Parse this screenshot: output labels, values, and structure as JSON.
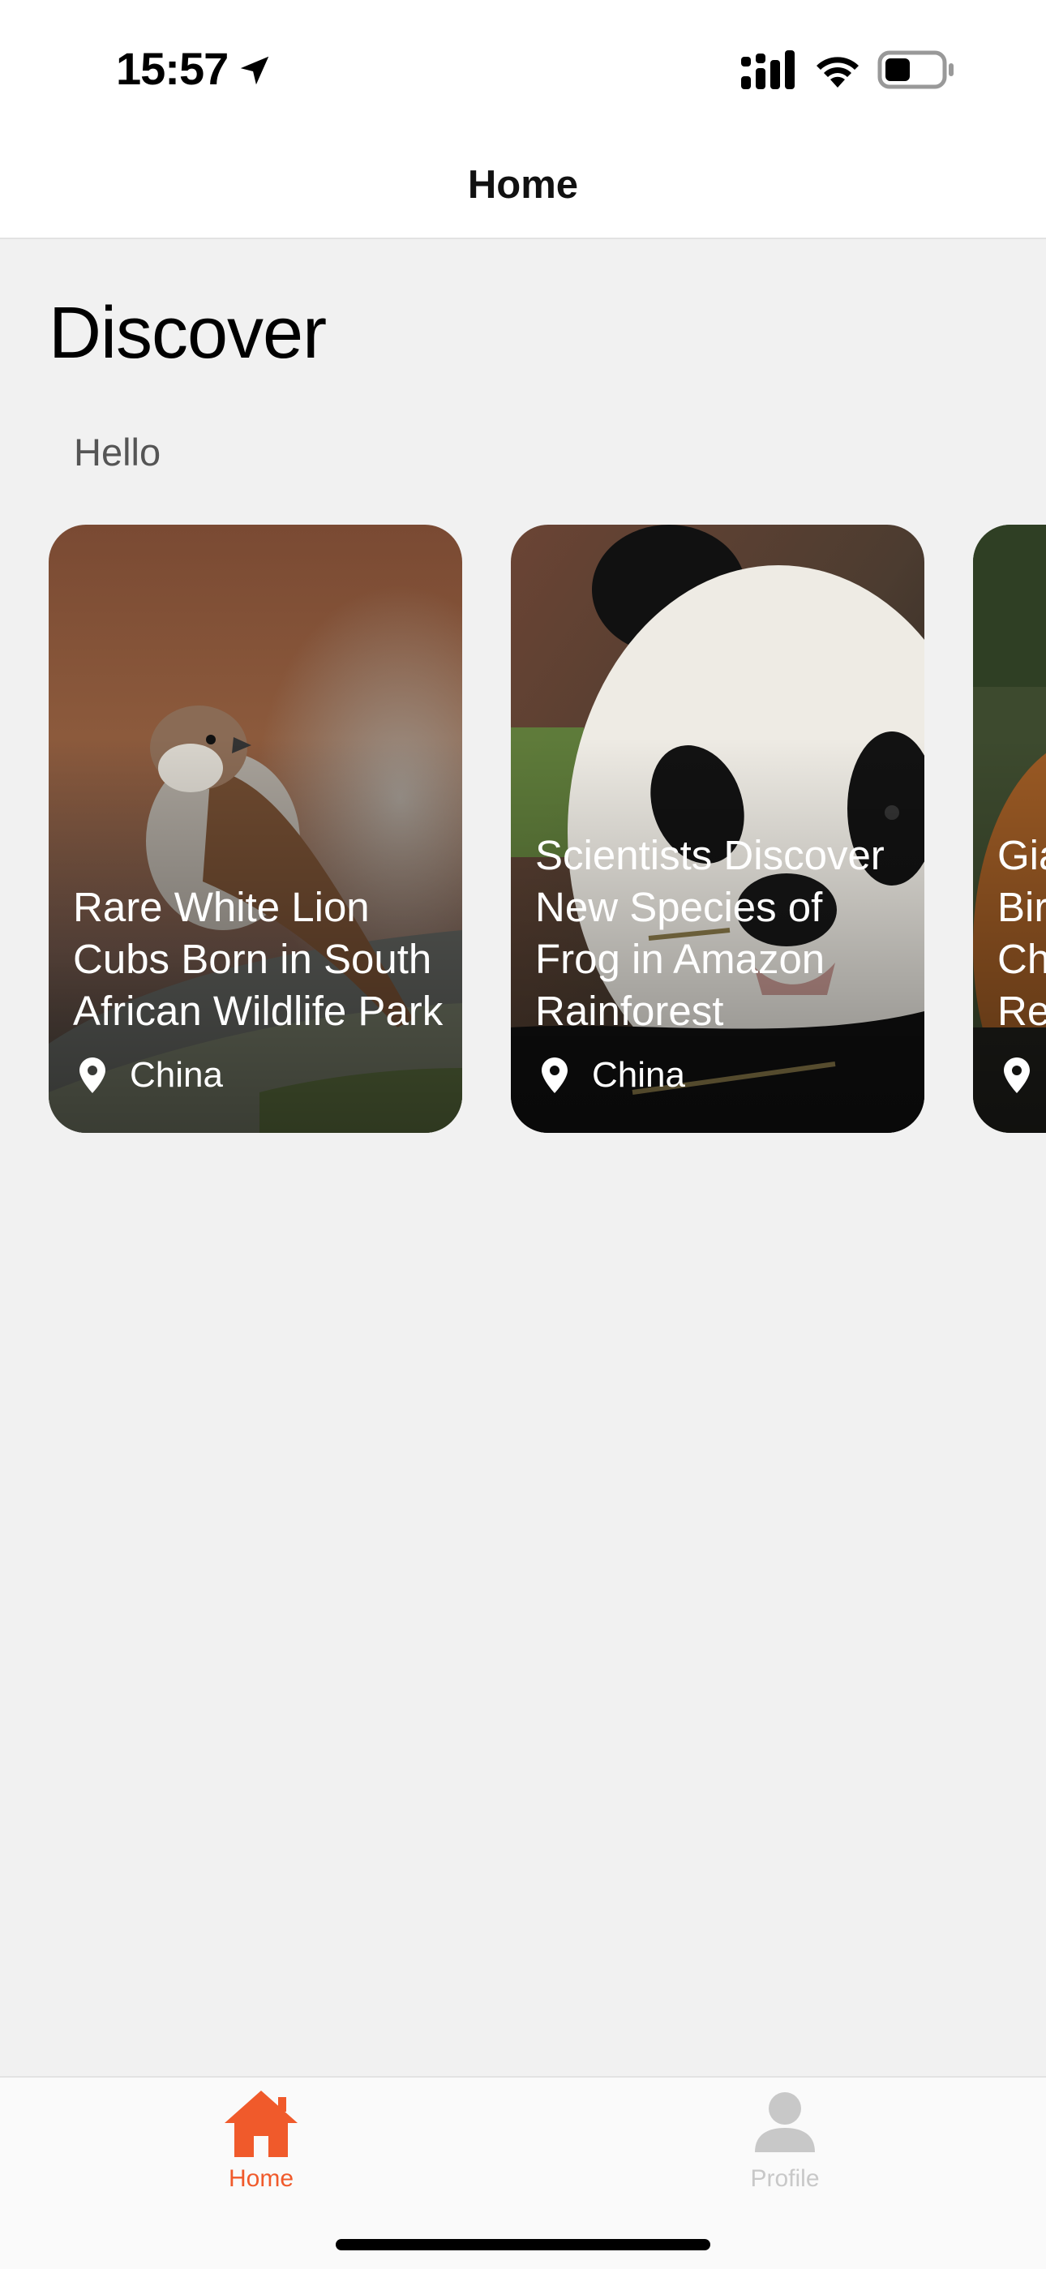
{
  "status_bar": {
    "time": "15:57",
    "icons": [
      "location-arrow-icon",
      "signal-icon",
      "wifi-icon",
      "battery-icon"
    ]
  },
  "nav": {
    "title": "Home"
  },
  "page": {
    "heading": "Discover",
    "greeting": "Hello"
  },
  "cards": [
    {
      "title": "Rare White Lion Cubs Born in South African Wildlife Park",
      "location": "China",
      "image": "sparrow on branch"
    },
    {
      "title": "Scientists Discover New Species of Frog in Amazon Rainforest",
      "location": "China",
      "image": "giant panda"
    },
    {
      "title": "Gia Bir Ch Re",
      "location": "",
      "image": "partially visible card"
    }
  ],
  "tab_bar": {
    "items": [
      {
        "label": "Home",
        "icon": "home-icon",
        "active": true
      },
      {
        "label": "Profile",
        "icon": "person-icon",
        "active": false
      }
    ],
    "active_color": "#F05A2B",
    "inactive_color": "#C8C8C8"
  }
}
